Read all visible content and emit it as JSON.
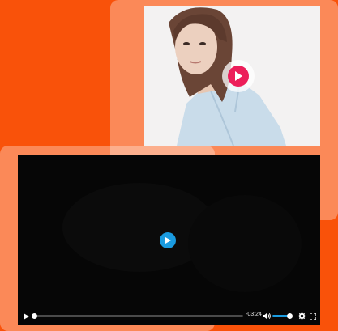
{
  "colors": {
    "background": "#f9520a",
    "photo_play_button": "#ec1e5a",
    "video_play_button": "#1a9be0",
    "volume_fill": "#1a9be0"
  },
  "photo_card": {
    "play_icon": "play-icon"
  },
  "video_player": {
    "center_icon": "play-icon",
    "controls": {
      "play_icon": "play-icon",
      "progress_fraction": 0.0,
      "time_remaining": "-03:24",
      "volume_icon": "speaker-icon",
      "volume_fraction": 1.0,
      "settings_icon": "gear-icon",
      "fullscreen_icon": "fullscreen-icon"
    }
  }
}
